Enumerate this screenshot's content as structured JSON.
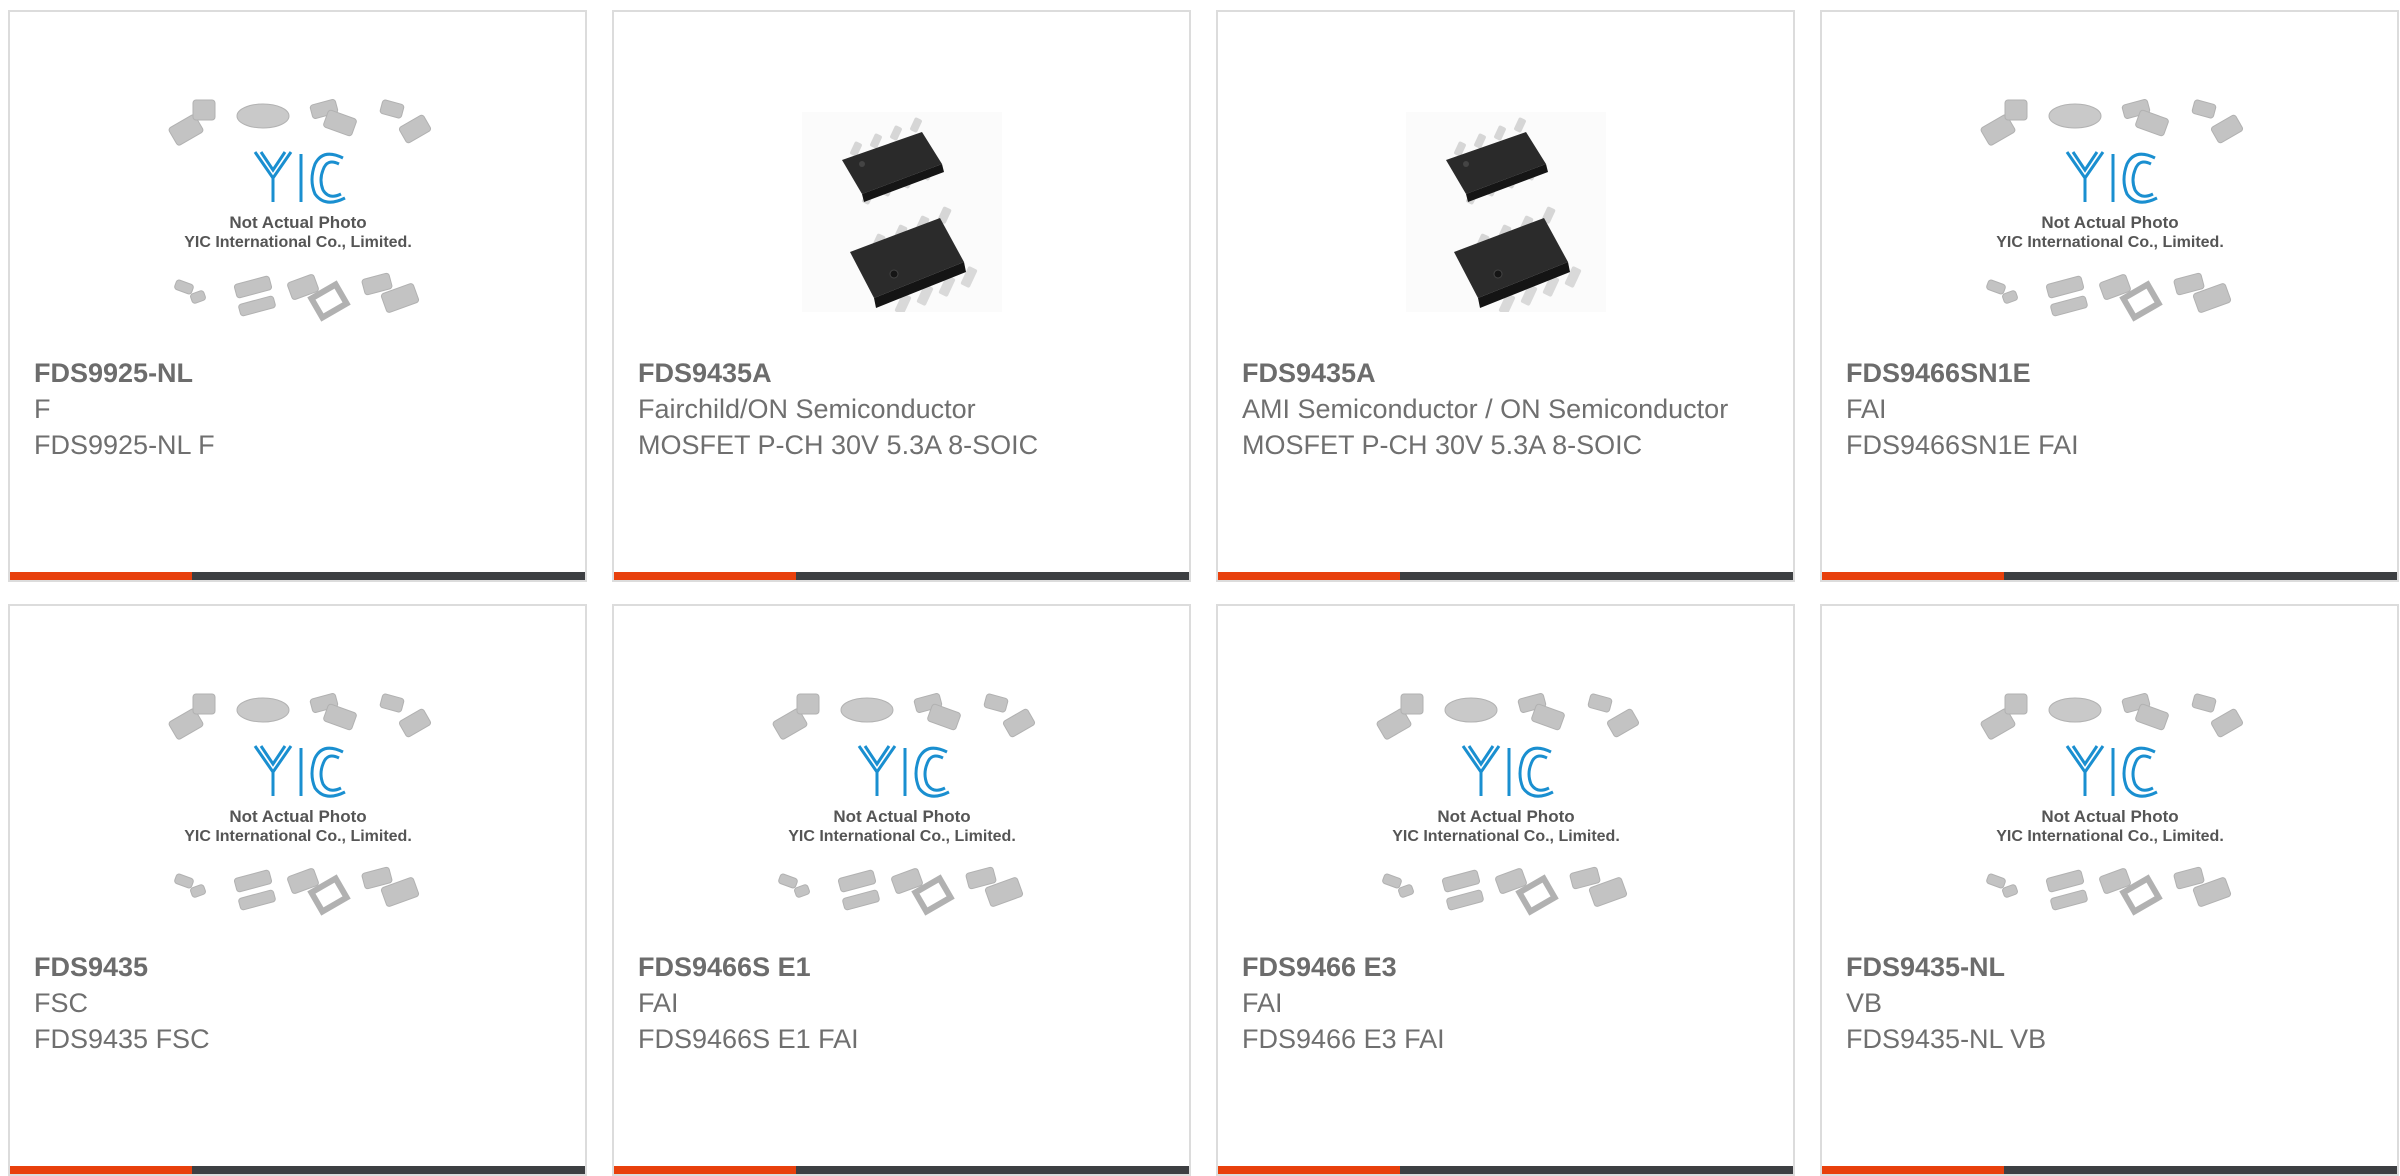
{
  "products": [
    {
      "part": "FDS9925-NL",
      "manufacturer": "F",
      "description": "FDS9925-NL F",
      "image": "yic-placeholder"
    },
    {
      "part": "FDS9435A",
      "manufacturer": "Fairchild/ON Semiconductor",
      "description": "MOSFET P-CH 30V 5.3A 8-SOIC",
      "image": "soic-8-photo"
    },
    {
      "part": "FDS9435A",
      "manufacturer": "AMI Semiconductor / ON Semiconductor",
      "description": "MOSFET P-CH 30V 5.3A 8-SOIC",
      "image": "soic-8-photo"
    },
    {
      "part": "FDS9466SN1E",
      "manufacturer": "FAI",
      "description": "FDS9466SN1E FAI",
      "image": "yic-placeholder"
    },
    {
      "part": "FDS9435",
      "manufacturer": "FSC",
      "description": "FDS9435 FSC",
      "image": "yic-placeholder"
    },
    {
      "part": "FDS9466S E1",
      "manufacturer": "FAI",
      "description": "FDS9466S E1 FAI",
      "image": "yic-placeholder"
    },
    {
      "part": "FDS9466 E3",
      "manufacturer": "FAI",
      "description": "FDS9466 E3 FAI",
      "image": "yic-placeholder"
    },
    {
      "part": "FDS9435-NL",
      "manufacturer": "VB",
      "description": "FDS9435-NL VB",
      "image": "yic-placeholder"
    }
  ],
  "placeholder": {
    "logo_text": "YIC",
    "line1": "Not Actual Photo",
    "line2": "YIC International Co., Limited."
  },
  "colors": {
    "accent": "#e8400c",
    "bar": "#3d3f42",
    "border": "#dcdcdc",
    "text": "#6f6f6f",
    "logo": "#1a8fd0"
  }
}
